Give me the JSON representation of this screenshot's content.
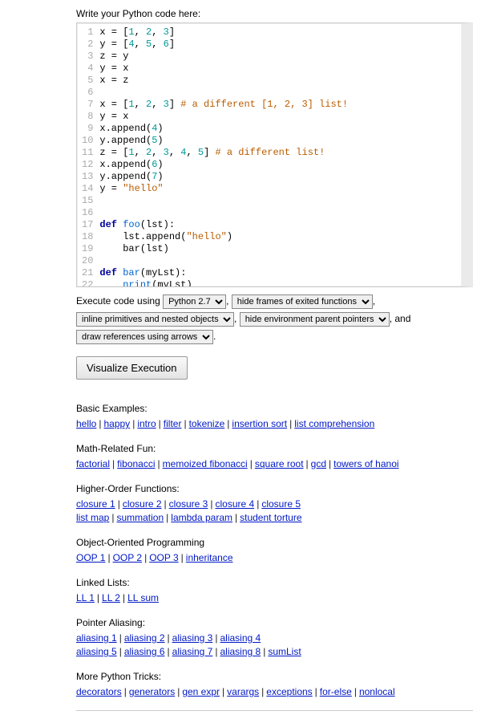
{
  "prompt": "Write your Python code here:",
  "code_lines": [
    {
      "n": "1",
      "h": "x = [<span class='nm'>1</span>, <span class='nm'>2</span>, <span class='nm'>3</span>]"
    },
    {
      "n": "2",
      "h": "y = [<span class='nm'>4</span>, <span class='nm'>5</span>, <span class='nm'>6</span>]"
    },
    {
      "n": "3",
      "h": "z = y"
    },
    {
      "n": "4",
      "h": "y = x"
    },
    {
      "n": "5",
      "h": "x = z"
    },
    {
      "n": "6",
      "h": ""
    },
    {
      "n": "7",
      "h": "x = [<span class='nm'>1</span>, <span class='nm'>2</span>, <span class='nm'>3</span>] <span class='cm'># a different [1, 2, 3] list!</span>"
    },
    {
      "n": "8",
      "h": "y = x"
    },
    {
      "n": "9",
      "h": "x.append(<span class='nm'>4</span>)"
    },
    {
      "n": "10",
      "h": "y.append(<span class='nm'>5</span>)"
    },
    {
      "n": "11",
      "h": "z = [<span class='nm'>1</span>, <span class='nm'>2</span>, <span class='nm'>3</span>, <span class='nm'>4</span>, <span class='nm'>5</span>] <span class='cm'># a different list!</span>"
    },
    {
      "n": "12",
      "h": "x.append(<span class='nm'>6</span>)"
    },
    {
      "n": "13",
      "h": "y.append(<span class='nm'>7</span>)"
    },
    {
      "n": "14",
      "h": "y = <span class='str'>\"hello\"</span>"
    },
    {
      "n": "15",
      "h": ""
    },
    {
      "n": "16",
      "h": ""
    },
    {
      "n": "17",
      "h": "<span class='kw'>def</span> <span class='fn'>foo</span>(lst):"
    },
    {
      "n": "18",
      "h": "    lst.append(<span class='str'>\"hello\"</span>)"
    },
    {
      "n": "19",
      "h": "    bar(lst)"
    },
    {
      "n": "20",
      "h": ""
    },
    {
      "n": "21",
      "h": "<span class='kw'>def</span> <span class='fn'>bar</span>(myLst):"
    },
    {
      "n": "22",
      "h": "    <span class='fn'>nrint</span>(myLst)"
    }
  ],
  "controls": {
    "exec_prefix": "Execute code using",
    "python_sel": "Python 2.7",
    "frames_sel": "hide frames of exited functions",
    "primitives_sel": "inline primitives and nested objects",
    "env_sel": "hide environment parent pointers",
    "and": ", and",
    "refs_sel": "draw references using arrows",
    "period": ".",
    "comma": ",",
    "vis_btn": "Visualize Execution"
  },
  "sections": [
    {
      "title": "Basic Examples:",
      "links": [
        "hello",
        "happy",
        "intro",
        "filter",
        "tokenize",
        "insertion sort",
        "list comprehension"
      ]
    },
    {
      "title": "Math-Related Fun:",
      "links": [
        "factorial",
        "fibonacci",
        "memoized fibonacci",
        "square root",
        "gcd",
        "towers of hanoi"
      ]
    },
    {
      "title": "Higher-Order Functions:",
      "rows": [
        [
          "closure 1",
          "closure 2",
          "closure 3",
          "closure 4",
          "closure 5"
        ],
        [
          "list map",
          "summation",
          "lambda param",
          "student torture"
        ]
      ]
    },
    {
      "title": "Object-Oriented Programming",
      "links": [
        "OOP 1",
        "OOP 2",
        "OOP 3",
        "inheritance"
      ]
    },
    {
      "title": "Linked Lists:",
      "links": [
        "LL 1",
        "LL 2",
        "LL sum"
      ]
    },
    {
      "title": "Pointer Aliasing:",
      "rows": [
        [
          "aliasing 1",
          "aliasing 2",
          "aliasing 3",
          "aliasing 4"
        ],
        [
          "aliasing 5",
          "aliasing 6",
          "aliasing 7",
          "aliasing 8",
          "sumList"
        ]
      ]
    },
    {
      "title": "More Python Tricks:",
      "links": [
        "decorators",
        "generators",
        "gen expr",
        "varargs",
        "exceptions",
        "for-else",
        "nonlocal"
      ]
    }
  ]
}
